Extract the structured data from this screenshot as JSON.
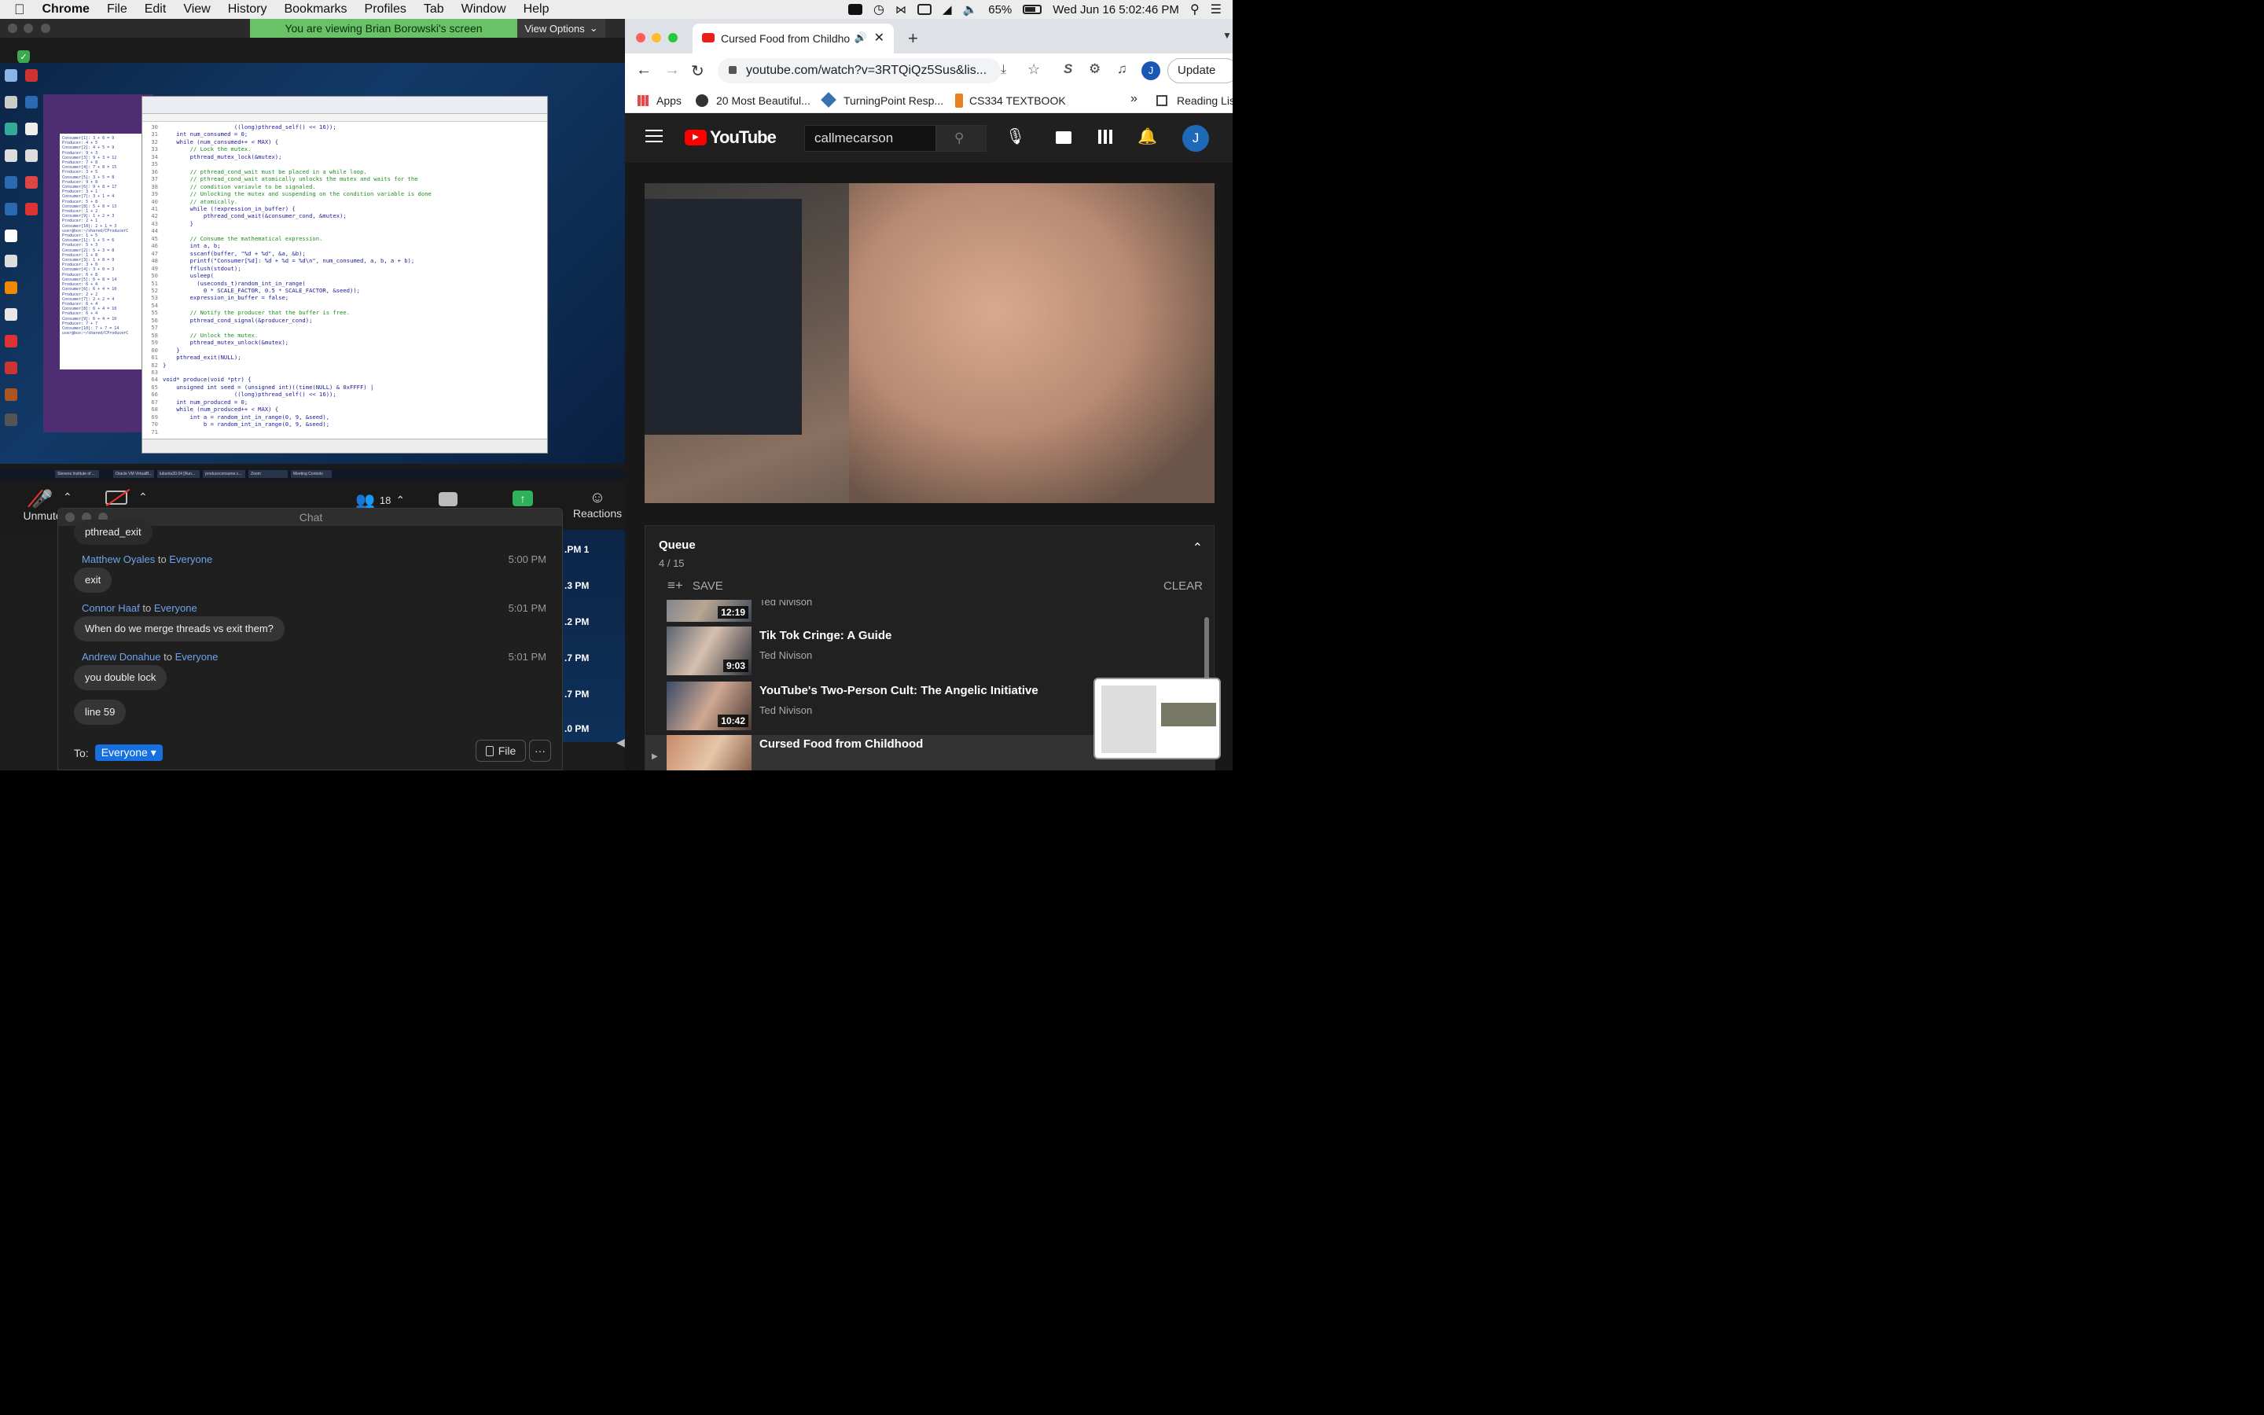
{
  "menubar": {
    "app_name": "Chrome",
    "items": [
      "File",
      "Edit",
      "View",
      "History",
      "Bookmarks",
      "Profiles",
      "Tab",
      "Window",
      "Help"
    ],
    "battery_percent": "65%",
    "clock": "Wed Jun 16  5:02:46 PM"
  },
  "zoom": {
    "banner": "You are viewing Brian Borowski's screen",
    "view_options": "View Options",
    "participants_count": "18",
    "unmute_label": "Unmute",
    "reactions_label": "Reactions",
    "strip_times": [
      ".PM 1",
      ".3 PM",
      ".2 PM",
      ".7 PM",
      ".7 PM",
      ".0 PM"
    ]
  },
  "shared_screen": {
    "terminal_lines": [
      "Consumer[1]: 3 + 6 = 9",
      "Producer: 4 + 5",
      "Consumer[2]: 4 + 5 = 9",
      "Producer: 9 + 3",
      "Consumer[3]: 9 + 3 = 12",
      "Producer: 7 + 8",
      "Consumer[4]: 7 + 8 = 15",
      "Producer: 3 + 5",
      "Consumer[5]: 3 + 5 = 8",
      "Producer: 9 + 8",
      "Consumer[6]: 9 + 8 = 17",
      "Producer: 3 + 1",
      "Consumer[7]: 3 + 1 = 4",
      "Producer: 5 + 8",
      "Consumer[8]: 5 + 8 = 13",
      "Producer: 1 + 2",
      "Consumer[9]: 1 + 2 = 3",
      "Producer: 2 + 1",
      "Consumer[10]: 2 + 1 = 3",
      "user@box:~/shared/CProducerC",
      "Producer: 1 + 5",
      "Consumer[1]: 1 + 5 = 6",
      "Producer: 5 + 3",
      "Consumer[2]: 5 + 3 = 8",
      "Producer: 1 + 8",
      "Consumer[3]: 1 + 8 = 9",
      "Producer: 3 + 0",
      "Consumer[4]: 3 + 0 = 3",
      "Producer: 6 + 8",
      "Consumer[5]: 6 + 8 = 14",
      "Producer: 6 + 4",
      "Consumer[6]: 6 + 4 = 10",
      "Producer: 2 + 2",
      "Consumer[7]: 2 + 2 = 4",
      "Producer: 6 + 4",
      "Consumer[8]: 6 + 4 = 10",
      "Producer: 6 + 4",
      "Consumer[9]: 6 + 4 = 10",
      "Producer: 7 + 7",
      "Consumer[10]: 7 + 7 = 14",
      "user@box:~/shared/CProducerC"
    ],
    "code_lines": [
      {
        "n": "30",
        "t": "                     ((long)pthread_self() << 16));",
        "c": ""
      },
      {
        "n": "31",
        "t": "    int num_consumed = 0;",
        "c": ""
      },
      {
        "n": "32",
        "t": "    while (num_consumed++ < MAX) {",
        "c": ""
      },
      {
        "n": "33",
        "t": "        // Lock the mutex.",
        "c": "cm"
      },
      {
        "n": "34",
        "t": "        pthread_mutex_lock(&mutex);",
        "c": ""
      },
      {
        "n": "35",
        "t": "",
        "c": ""
      },
      {
        "n": "36",
        "t": "        // pthread_cond_wait must be placed in a while loop.",
        "c": "cm"
      },
      {
        "n": "37",
        "t": "        // pthread_cond_wait atomically unlocks the mutex and waits for the",
        "c": "cm"
      },
      {
        "n": "38",
        "t": "        // condition variavle to be signaled.",
        "c": "cm"
      },
      {
        "n": "39",
        "t": "        // Unlocking the mutex and suspending on the condition variable is done",
        "c": "cm"
      },
      {
        "n": "40",
        "t": "        // atomically.",
        "c": "cm"
      },
      {
        "n": "41",
        "t": "        while (!expression_in_buffer) {",
        "c": ""
      },
      {
        "n": "42",
        "t": "            pthread_cond_wait(&consumer_cond, &mutex);",
        "c": ""
      },
      {
        "n": "43",
        "t": "        }",
        "c": ""
      },
      {
        "n": "44",
        "t": "",
        "c": ""
      },
      {
        "n": "45",
        "t": "        // Consume the mathematical expression.",
        "c": "cm"
      },
      {
        "n": "46",
        "t": "        int a, b;",
        "c": ""
      },
      {
        "n": "47",
        "t": "        sscanf(buffer, \"%d + %d\", &a, &b);",
        "c": ""
      },
      {
        "n": "48",
        "t": "        printf(\"Consumer[%d]: %d + %d = %d\\n\", num_consumed, a, b, a + b);",
        "c": ""
      },
      {
        "n": "49",
        "t": "        fflush(stdout);",
        "c": ""
      },
      {
        "n": "50",
        "t": "        usleep(",
        "c": ""
      },
      {
        "n": "51",
        "t": "          (useconds_t)random_int_in_range(",
        "c": ""
      },
      {
        "n": "52",
        "t": "            0 * SCALE_FACTOR, 0.5 * SCALE_FACTOR, &seed));",
        "c": ""
      },
      {
        "n": "53",
        "t": "        expression_in_buffer = false;",
        "c": ""
      },
      {
        "n": "54",
        "t": "",
        "c": ""
      },
      {
        "n": "55",
        "t": "        // Notify the producer that the buffer is free.",
        "c": "cm"
      },
      {
        "n": "56",
        "t": "        pthread_cond_signal(&producer_cond);",
        "c": ""
      },
      {
        "n": "57",
        "t": "",
        "c": ""
      },
      {
        "n": "58",
        "t": "        // Unlock the mutex.",
        "c": "cm"
      },
      {
        "n": "59",
        "t": "        pthread_mutex_unlock(&mutex);",
        "c": ""
      },
      {
        "n": "60",
        "t": "    }",
        "c": ""
      },
      {
        "n": "61",
        "t": "    pthread_exit(NULL);",
        "c": ""
      },
      {
        "n": "62",
        "t": "}",
        "c": ""
      },
      {
        "n": "63",
        "t": "",
        "c": ""
      },
      {
        "n": "64",
        "t": "void* produce(void *ptr) {",
        "c": ""
      },
      {
        "n": "65",
        "t": "    unsigned int seed = (unsigned int)((time(NULL) & 0xFFFF) |",
        "c": ""
      },
      {
        "n": "66",
        "t": "                     ((long)pthread_self() << 16));",
        "c": ""
      },
      {
        "n": "67",
        "t": "    int num_produced = 0;",
        "c": ""
      },
      {
        "n": "68",
        "t": "    while (num_produced++ < MAX) {",
        "c": ""
      },
      {
        "n": "69",
        "t": "        int a = random_int_in_range(0, 9, &seed),",
        "c": ""
      },
      {
        "n": "70",
        "t": "            b = random_int_in_range(0, 9, &seed);",
        "c": ""
      },
      {
        "n": "71",
        "t": "",
        "c": ""
      }
    ],
    "taskbar_items": [
      "Stevens Institute of ...",
      "Oracle VM VirtualB...",
      "lubuntu20.04 [Run...",
      "produceconsume.c...",
      "Zoom",
      "Meeting Controls"
    ]
  },
  "chat": {
    "title": "Chat",
    "messages": [
      {
        "text": "pthread_exit"
      },
      {
        "sender": "Matthew Oyales",
        "to": "Everyone",
        "time": "5:00 PM",
        "text": "exit"
      },
      {
        "sender": "Connor Haaf",
        "to": "Everyone",
        "time": "5:01 PM",
        "text": "When do we merge threads vs exit them?"
      },
      {
        "sender": "Andrew Donahue",
        "to": "Everyone",
        "time": "5:01 PM",
        "text": "you double lock"
      },
      {
        "text": "line 59"
      }
    ],
    "to_label": "To:",
    "to_value": "Everyone",
    "to_word": "to",
    "file_label": "File",
    "more_label": "···"
  },
  "chrome": {
    "tab_title": "Cursed Food from Childho",
    "url": "youtube.com/watch?v=3RTQiQz5Sus&lis...",
    "update_label": "Update",
    "avatar_letter": "J",
    "bookmarks": [
      "Apps",
      "20 Most Beautiful...",
      "TurningPoint Resp...",
      "CS334 TEXTBOOK",
      "Reading Lis"
    ]
  },
  "youtube": {
    "logo_text": "YouTube",
    "search_value": "callmecarson",
    "avatar_letter": "J",
    "queue_title": "Queue",
    "queue_count": "4 / 15",
    "save_label": "SAVE",
    "clear_label": "CLEAR",
    "queue_items": [
      {
        "title": "",
        "channel": "Ted Nivison",
        "duration": "12:19"
      },
      {
        "title": "Tik Tok Cringe: A Guide",
        "channel": "Ted Nivison",
        "duration": "9:03"
      },
      {
        "title": "YouTube's Two-Person Cult: The Angelic Initiative",
        "channel": "Ted Nivison",
        "duration": "10:42"
      },
      {
        "title": "Cursed Food from Childhood",
        "channel": "",
        "duration": ""
      }
    ]
  }
}
